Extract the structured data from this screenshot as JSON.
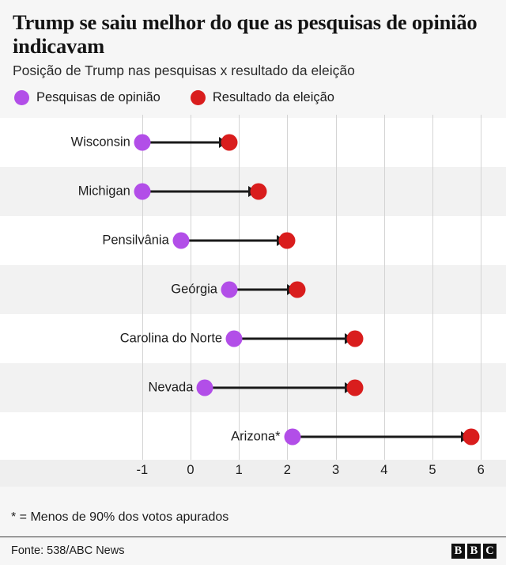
{
  "header": {
    "title": "Trump se saiu melhor do que as pesquisas de opinião indicavam",
    "subtitle": "Posição de Trump nas pesquisas x resultado da eleição"
  },
  "legend": {
    "items": [
      {
        "label": "Pesquisas de opinião",
        "color": "#b24ee8",
        "icon": "circle-icon"
      },
      {
        "label": "Resultado da eleição",
        "color": "#d91d1d",
        "icon": "circle-icon"
      }
    ]
  },
  "footnote": "* = Menos de 90% dos votos apurados",
  "source": {
    "text": "Fonte: 538/ABC News",
    "logo": [
      "B",
      "B",
      "C"
    ]
  },
  "chart_data": {
    "type": "scatter",
    "title": "Trump se saiu melhor do que as pesquisas de opinião indicavam",
    "subtitle": "Posição de Trump nas pesquisas x resultado da eleição",
    "xlabel": "",
    "ylabel": "",
    "xlim": [
      -1.55,
      6.5
    ],
    "xticks": [
      -1,
      0,
      1,
      2,
      3,
      4,
      5,
      6
    ],
    "xtick_labels": [
      "-1",
      "0",
      "1",
      "2",
      "3",
      "4",
      "5",
      "6"
    ],
    "grid": true,
    "legend_position": "top",
    "categories": [
      "Wisconsin",
      "Michigan",
      "Pensilvânia",
      "Geórgia",
      "Carolina do Norte",
      "Nevada",
      "Arizona*"
    ],
    "series": [
      {
        "name": "Pesquisas de opinião",
        "color": "#b24ee8",
        "values": [
          -1.0,
          -1.0,
          -0.2,
          0.8,
          0.9,
          0.3,
          2.1
        ]
      },
      {
        "name": "Resultado da eleição",
        "color": "#d91d1d",
        "values": [
          0.8,
          1.4,
          2.0,
          2.2,
          3.4,
          3.4,
          5.8
        ]
      }
    ]
  }
}
